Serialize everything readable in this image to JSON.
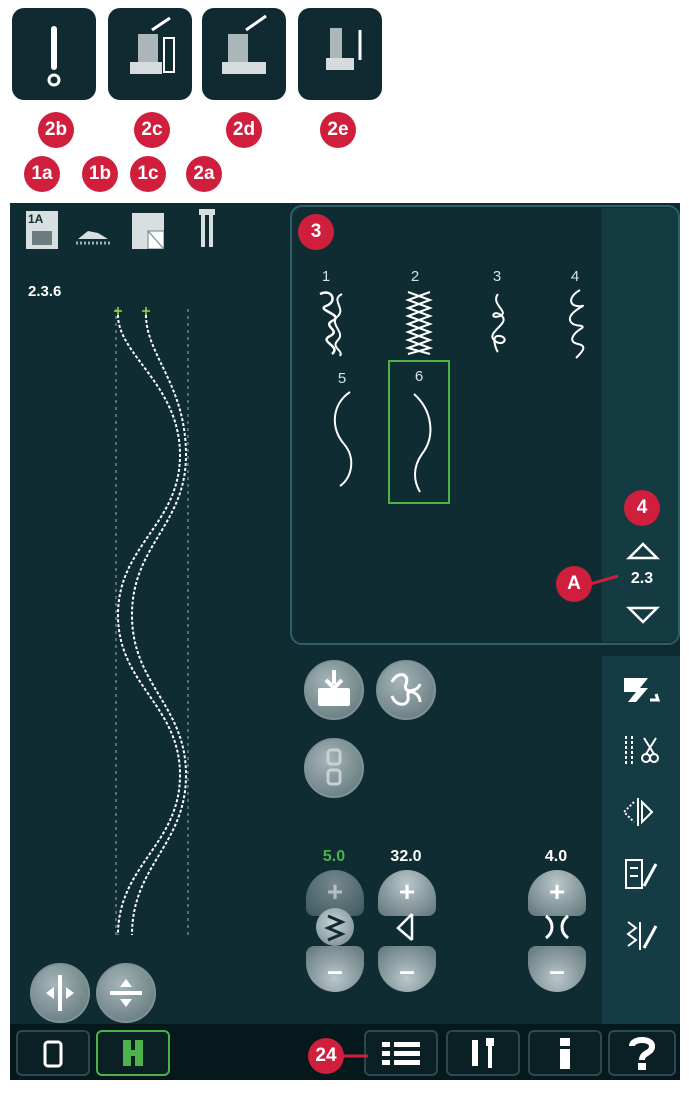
{
  "callouts": {
    "b1a": "1a",
    "b1b": "1b",
    "b1c": "1c",
    "b2a": "2a",
    "b2b": "2b",
    "b2c": "2c",
    "b2d": "2d",
    "b2e": "2e",
    "b3": "3",
    "b4": "4",
    "bA": "A",
    "b24": "24"
  },
  "left": {
    "stitch_id": "2.3.6",
    "presser_foot": "1A"
  },
  "stitches": [
    {
      "num": "1"
    },
    {
      "num": "2"
    },
    {
      "num": "3"
    },
    {
      "num": "4"
    },
    {
      "num": "5"
    },
    {
      "num": "6"
    }
  ],
  "selected_stitch": "6",
  "scroll": {
    "value": "2.3"
  },
  "settings": {
    "width": "5.0",
    "length": "32.0",
    "balance": "4.0"
  },
  "colors": {
    "accent_green": "#4db24a",
    "callout_red": "#cf1f3d",
    "screen_bg": "#0f2c33"
  }
}
